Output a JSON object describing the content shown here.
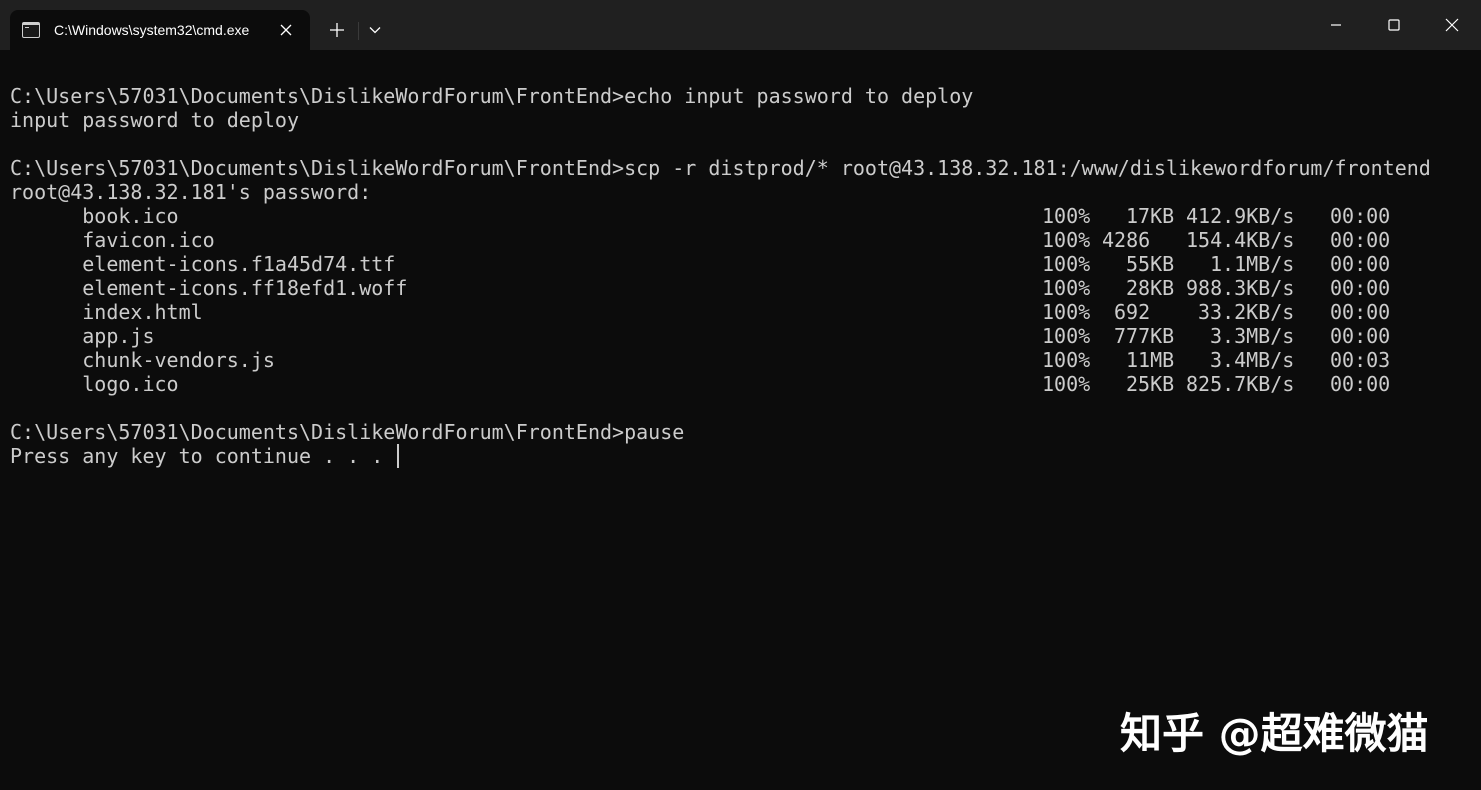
{
  "window": {
    "tab_title": "C:\\Windows\\system32\\cmd.exe",
    "colors": {
      "background": "#0c0c0c",
      "titlebar": "#202020",
      "text": "#cccccc"
    },
    "icons": {
      "tab": "cmd-icon",
      "tab_close": "close-icon",
      "new_tab": "plus-icon",
      "dropdown": "chevron-down-icon",
      "minimize": "minimize-icon",
      "maximize": "maximize-icon",
      "close": "close-icon"
    }
  },
  "console": {
    "echo_prompt": "C:\\Users\\57031\\Documents\\DislikeWordForum\\FrontEnd>echo input password to deploy",
    "echo_output": "input password to deploy",
    "scp_prompt": "C:\\Users\\57031\\Documents\\DislikeWordForum\\FrontEnd>scp -r distprod/* root@43.138.32.181:/www/dislikewordforum/frontend",
    "password_prompt": "root@43.138.32.181's password:",
    "files": [
      {
        "name": "book.ico",
        "percent": "100%",
        "size": "17KB",
        "rate": "412.9KB/s",
        "time": "00:00"
      },
      {
        "name": "favicon.ico",
        "percent": "100%",
        "size": "4286",
        "rate": "154.4KB/s",
        "time": "00:00"
      },
      {
        "name": "element-icons.f1a45d74.ttf",
        "percent": "100%",
        "size": "55KB",
        "rate": "1.1MB/s",
        "time": "00:00"
      },
      {
        "name": "element-icons.ff18efd1.woff",
        "percent": "100%",
        "size": "28KB",
        "rate": "988.3KB/s",
        "time": "00:00"
      },
      {
        "name": "index.html",
        "percent": "100%",
        "size": "692",
        "rate": "33.2KB/s",
        "time": "00:00"
      },
      {
        "name": "app.js",
        "percent": "100%",
        "size": "777KB",
        "rate": "3.3MB/s",
        "time": "00:00"
      },
      {
        "name": "chunk-vendors.js",
        "percent": "100%",
        "size": "11MB",
        "rate": "3.4MB/s",
        "time": "00:03"
      },
      {
        "name": "logo.ico",
        "percent": "100%",
        "size": "25KB",
        "rate": "825.7KB/s",
        "time": "00:00"
      }
    ],
    "pause_prompt": "C:\\Users\\57031\\Documents\\DislikeWordForum\\FrontEnd>pause",
    "pause_output": "Press any key to continue . . . "
  },
  "watermark": "知乎 @超难微猫"
}
